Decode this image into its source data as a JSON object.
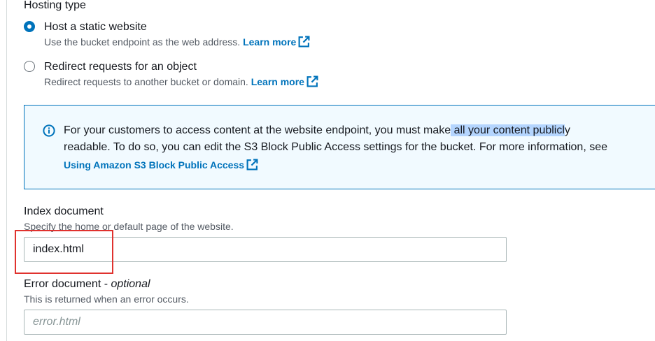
{
  "hosting": {
    "label": "Hosting type",
    "options": [
      {
        "title": "Host a static website",
        "description": "Use the bucket endpoint as the web address.",
        "link": "Learn more",
        "selected": true
      },
      {
        "title": "Redirect requests for an object",
        "description": "Redirect requests to another bucket or domain.",
        "link": "Learn more",
        "selected": false
      }
    ]
  },
  "alert": {
    "line1_before": "For your customers to access content at the website endpoint, you must make",
    "line1_highlight": " all your content publicl",
    "line1_after": "y",
    "line2": "readable. To do so, you can edit the S3 Block Public Access settings for the bucket. For more information, see",
    "link": "Using Amazon S3 Block Public Access",
    "accent_color": "#0073bb",
    "background_color": "#f1faff"
  },
  "index_document": {
    "label": "Index document",
    "description": "Specify the home or default page of the website.",
    "value": "index.html"
  },
  "error_document": {
    "label": "Error document - ",
    "label_optional": "optional",
    "description": "This is returned when an error occurs.",
    "placeholder": "error.html"
  },
  "icons": {
    "external": "external-link-icon",
    "info": "info-icon"
  }
}
